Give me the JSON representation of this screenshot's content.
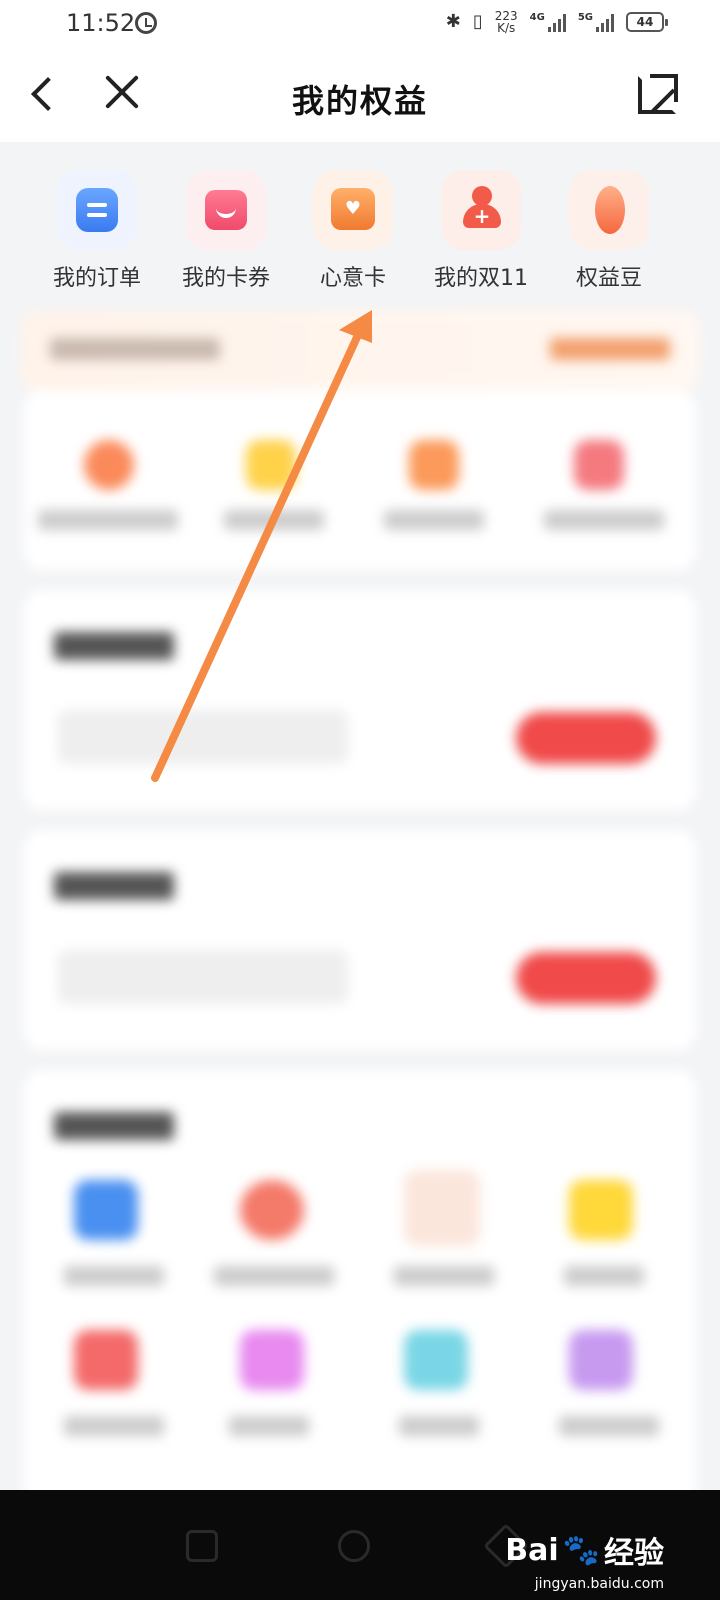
{
  "status_bar": {
    "time": "11:52",
    "speed_value": "223",
    "speed_unit": "K/s",
    "net1": "4G",
    "net2": "5G",
    "battery": "44"
  },
  "nav": {
    "title": "我的权益"
  },
  "quick_actions": [
    {
      "label": "我的订单",
      "icon": "order-icon"
    },
    {
      "label": "我的卡券",
      "icon": "coupon-icon"
    },
    {
      "label": "心意卡",
      "icon": "gift-card-icon"
    },
    {
      "label": "我的双11",
      "icon": "double11-icon"
    },
    {
      "label": "权益豆",
      "icon": "bean-icon"
    }
  ],
  "watermark": {
    "brand": "Bai",
    "brand2": "经验",
    "url": "jingyan.baidu.com"
  },
  "colors": {
    "accent_arrow": "#f48a44",
    "button_red": "#f04a4a"
  }
}
